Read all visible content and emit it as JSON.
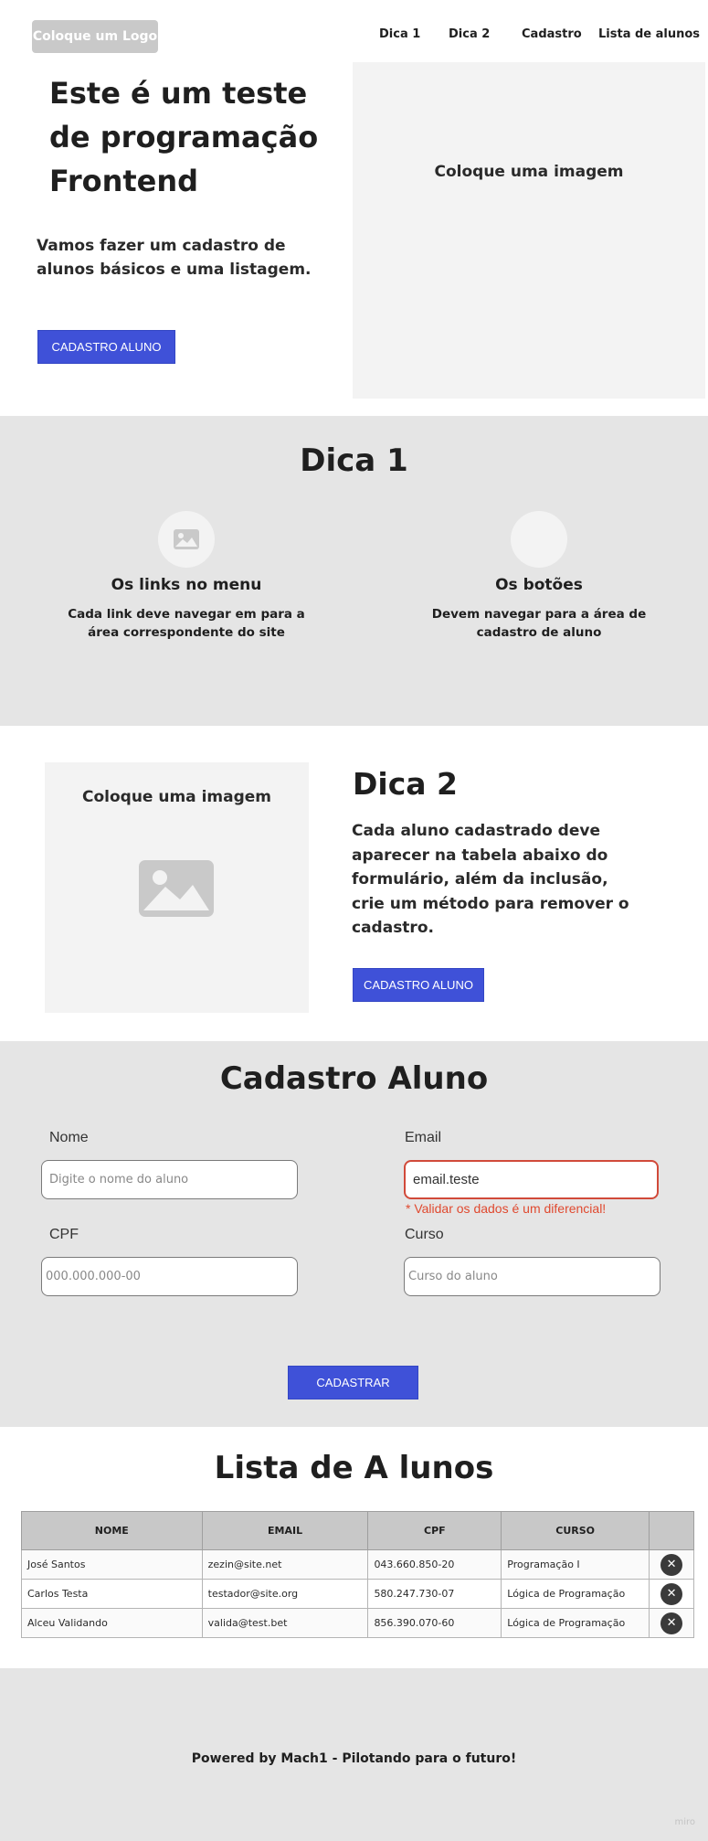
{
  "header": {
    "logo": "Coloque um Logo",
    "nav": [
      "Dica 1",
      "Dica 2",
      "Cadastro",
      "Lista de alunos"
    ]
  },
  "hero": {
    "title": "Este é um teste de programação Frontend",
    "text": "Vamos fazer um cadastro de alunos básicos e uma listagem.",
    "button": "CADASTRO ALUNO",
    "image_label": "Coloque uma imagem"
  },
  "dica1": {
    "title": "Dica 1",
    "cards": [
      {
        "title": "Os links no menu",
        "text": "Cada link deve navegar em para a área correspondente do site",
        "icon": "image-icon"
      },
      {
        "title": "Os botões",
        "text": "Devem navegar para a área de cadastro de aluno",
        "icon": "empty-circle"
      }
    ]
  },
  "dica2": {
    "title": "Dica 2",
    "text": "Cada aluno cadastrado deve aparecer na tabela abaixo do formulário, além da inclusão, crie um método para remover o cadastro.",
    "button": "CADASTRO ALUNO",
    "image_label": "Coloque uma imagem"
  },
  "cadastro": {
    "title": "Cadastro Aluno",
    "fields": {
      "nome": {
        "label": "Nome",
        "placeholder": "Digite o nome do aluno",
        "value": ""
      },
      "email": {
        "label": "Email",
        "placeholder": "",
        "value": "email.teste",
        "error": "* Validar os dados é um diferencial!"
      },
      "cpf": {
        "label": "CPF",
        "placeholder": "000.000.000-00",
        "value": ""
      },
      "curso": {
        "label": "Curso",
        "placeholder": "Curso do aluno",
        "value": ""
      }
    },
    "submit": "CADASTRAR"
  },
  "lista": {
    "title": "Lista de A lunos",
    "columns": [
      "NOME",
      "EMAIL",
      "CPF",
      "CURSO"
    ],
    "rows": [
      {
        "nome": "José Santos",
        "email": "zezin@site.net",
        "cpf": "043.660.850-20",
        "curso": "Programação I"
      },
      {
        "nome": "Carlos Testa",
        "email": "testador@site.org",
        "cpf": "580.247.730-07",
        "curso": "Lógica de Programação"
      },
      {
        "nome": "Alceu Validando",
        "email": "valida@test.bet",
        "cpf": "856.390.070-60",
        "curso": "Lógica de Programação"
      }
    ]
  },
  "footer": {
    "text": "Powered by Mach1 - Pilotando para o futuro!",
    "watermark": "miro"
  },
  "colors": {
    "primary_button": "#3f51d8",
    "gray_band": "#e5e5e5",
    "placeholder_bg": "#f3f3f3",
    "error": "#e0492f",
    "table_header": "#c8c8c8"
  }
}
